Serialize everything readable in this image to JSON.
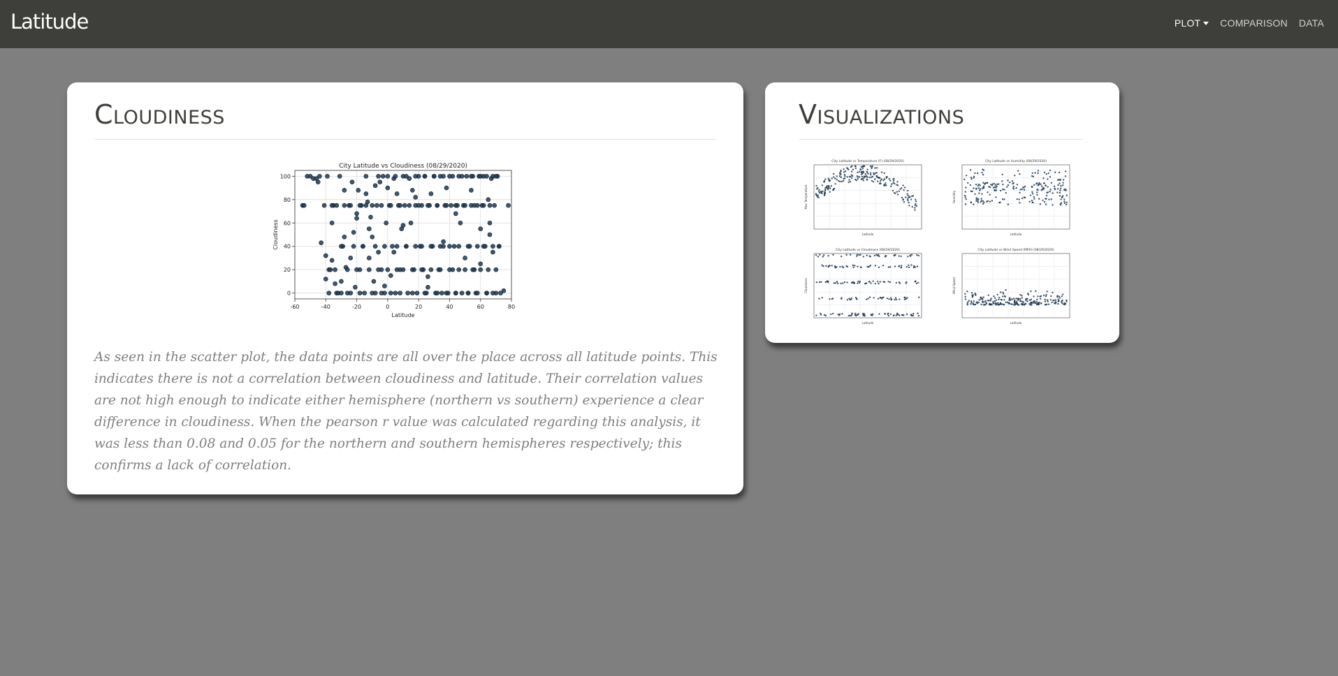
{
  "navbar": {
    "brand": "Latitude",
    "links": [
      {
        "label": "PLOT",
        "has_caret": true,
        "active": true
      },
      {
        "label": "COMPARISON"
      },
      {
        "label": "DATA"
      }
    ]
  },
  "main_card": {
    "title": "Cloudiness",
    "description": "As seen in the scatter plot, the data points are all over the place across all latitude points. This indicates there is not a correlation between cloudiness and latitude. Their correlation values are not high enough to indicate either hemisphere (northern vs southern) experience a clear difference in cloudiness. When the pearson r value was calculated regarding this analysis, it was less than 0.08 and 0.05 for the northern and southern hemispheres respectively; this confirms a lack of correlation."
  },
  "viz_card": {
    "title": "Visualizations",
    "thumbnails": [
      {
        "title": "City Latitude vs Temperature (F) (08/29/2020)",
        "xlabel": "Latitude",
        "ylabel": "Max Temperature"
      },
      {
        "title": "City Latitude vs Humidity (08/29/2020)",
        "xlabel": "Latitude",
        "ylabel": "Humidity"
      },
      {
        "title": "City Latitude vs Cloudiness (08/29/2020)",
        "xlabel": "Latitude",
        "ylabel": "Cloudiness"
      },
      {
        "title": "City Latitude vs Wind Speed (MPH) (08/29/2020)",
        "xlabel": "Latitude",
        "ylabel": "Wind Speed"
      }
    ]
  },
  "chart_data": [
    {
      "type": "scatter",
      "title": "City Latitude vs Cloudiness (08/29/2020)",
      "xlabel": "Latitude",
      "ylabel": "Cloudiness",
      "xlim": [
        -60,
        80
      ],
      "ylim": [
        -5,
        105
      ],
      "xticks": [
        -60,
        -40,
        -20,
        0,
        20,
        40,
        60,
        80
      ],
      "yticks": [
        0,
        20,
        40,
        60,
        80,
        100
      ],
      "grid": true,
      "marker_color": "#1f3a54",
      "series": [
        {
          "x": [
            -52,
            -48,
            -45,
            -44,
            -41,
            -38,
            -36,
            -35,
            -33,
            -31,
            -29,
            -28,
            -27,
            -26,
            -25,
            -24,
            -23,
            -21,
            -20,
            -19,
            -18,
            -17,
            -16,
            -15,
            -14,
            -13,
            -12,
            -11,
            -10,
            -9,
            -8,
            -7,
            -6,
            -5,
            -4,
            -3,
            -2,
            -1,
            0,
            1,
            2,
            3,
            4,
            5,
            6,
            7,
            8,
            9,
            10,
            11,
            12,
            13,
            14,
            15,
            16,
            17,
            18,
            19,
            20,
            21,
            22,
            23,
            24,
            25,
            26,
            27,
            28,
            29,
            30,
            31,
            32,
            33,
            34,
            35,
            36,
            37,
            38,
            39,
            40,
            41,
            42,
            43,
            44,
            45,
            46,
            47,
            48,
            49,
            50,
            51,
            52,
            53,
            54,
            55,
            56,
            57,
            58,
            59,
            60,
            61,
            62,
            63,
            64,
            65,
            66,
            67,
            68,
            69,
            70,
            71,
            72,
            73,
            75,
            78,
            -55,
            -54,
            -50,
            -46,
            -43,
            -40,
            -39,
            -37,
            -34,
            -32,
            -30,
            -22,
            -12,
            -6,
            0,
            5,
            12,
            18,
            24,
            30,
            36,
            42,
            48,
            54,
            60,
            64,
            68,
            70,
            -36,
            -33,
            -28,
            -24,
            -18,
            -14,
            -10,
            -4,
            2,
            8,
            14,
            20,
            26,
            32,
            38,
            44,
            50,
            56,
            62,
            66,
            -30,
            -22,
            -16,
            -8,
            -2,
            6,
            12,
            18,
            22,
            28,
            34,
            40,
            46,
            52,
            58,
            62,
            68,
            72,
            -34,
            -26,
            -20,
            -12,
            -6,
            0,
            6,
            10,
            16,
            22,
            28,
            34,
            40,
            46,
            50,
            55,
            60,
            65,
            70,
            -38,
            -30,
            -24,
            -18,
            -10,
            -4,
            2,
            8,
            16,
            24,
            32,
            38,
            44,
            52,
            58,
            64,
            68,
            -40,
            -36,
            -28,
            -20,
            -14,
            -8,
            -2,
            4,
            10,
            18,
            26,
            36,
            44,
            54,
            60,
            66
          ],
          "y": [
            100,
            98,
            95,
            100,
            75,
            20,
            60,
            75,
            0,
            100,
            40,
            88,
            22,
            0,
            75,
            30,
            95,
            5,
            64,
            88,
            20,
            75,
            40,
            0,
            100,
            78,
            55,
            65,
            48,
            10,
            0,
            75,
            35,
            95,
            20,
            100,
            0,
            60,
            100,
            75,
            15,
            40,
            98,
            0,
            85,
            75,
            20,
            55,
            100,
            75,
            40,
            0,
            98,
            60,
            88,
            20,
            75,
            0,
            100,
            40,
            75,
            20,
            100,
            0,
            5,
            75,
            85,
            40,
            100,
            0,
            75,
            20,
            100,
            0,
            40,
            75,
            90,
            0,
            100,
            75,
            20,
            40,
            0,
            75,
            100,
            60,
            0,
            75,
            30,
            100,
            0,
            40,
            75,
            100,
            20,
            0,
            75,
            100,
            55,
            75,
            100,
            40,
            0,
            80,
            60,
            98,
            35,
            75,
            0,
            100,
            40,
            0,
            2,
            75,
            75,
            75,
            100,
            98,
            43,
            32,
            100,
            20,
            8,
            0,
            10,
            52,
            30,
            100,
            90,
            100,
            100,
            100,
            100,
            100,
            100,
            100,
            100,
            100,
            100,
            100,
            100,
            100,
            75,
            75,
            75,
            75,
            75,
            75,
            75,
            75,
            75,
            75,
            75,
            75,
            75,
            75,
            75,
            75,
            75,
            75,
            75,
            75,
            40,
            40,
            40,
            40,
            40,
            40,
            40,
            40,
            40,
            40,
            40,
            40,
            40,
            40,
            40,
            40,
            40,
            40,
            20,
            20,
            20,
            20,
            20,
            20,
            20,
            20,
            20,
            20,
            20,
            20,
            20,
            20,
            20,
            20,
            20,
            20,
            20,
            0,
            0,
            0,
            0,
            0,
            0,
            0,
            0,
            0,
            0,
            0,
            0,
            0,
            0,
            0,
            0,
            0,
            12,
            28,
            48,
            68,
            85,
            92,
            6,
            35,
            58,
            82,
            14,
            44,
            68,
            88,
            25,
            50
          ]
        }
      ]
    }
  ]
}
